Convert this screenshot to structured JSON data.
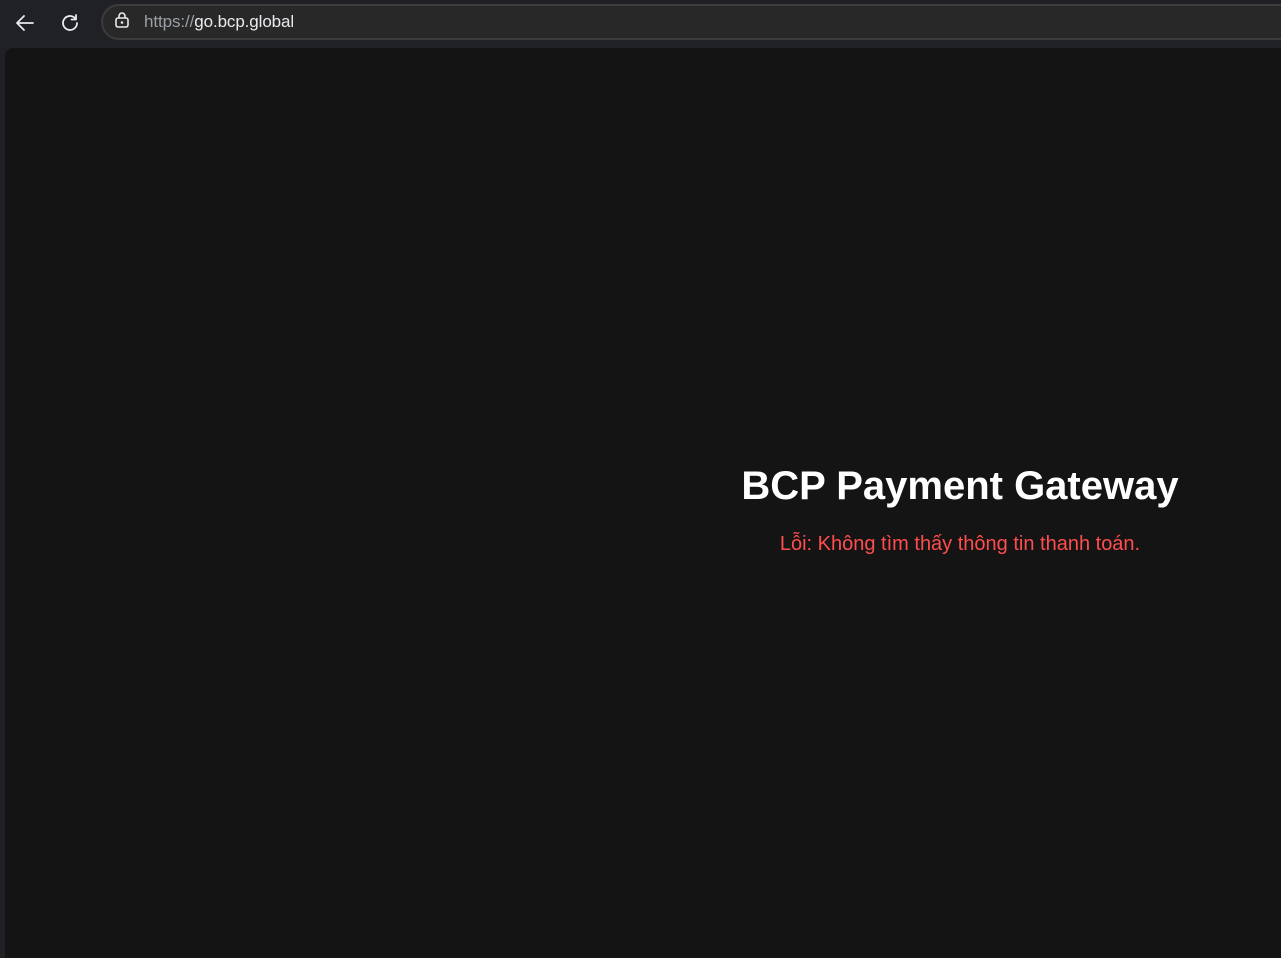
{
  "browser": {
    "back_icon": "arrow-left-icon",
    "reload_icon": "reload-icon",
    "site_info_icon": "lock-tune-icon",
    "address_bar": {
      "scheme": "https://",
      "host": "go.bcp.global"
    }
  },
  "page": {
    "title": "BCP Payment Gateway",
    "error_message": "Lỗi: Không tìm thấy thông tin thanh toán."
  },
  "colors": {
    "page_background": "#141414",
    "title": "#ffffff",
    "error": "#ff4d4d",
    "browser_chrome": "#202124"
  }
}
